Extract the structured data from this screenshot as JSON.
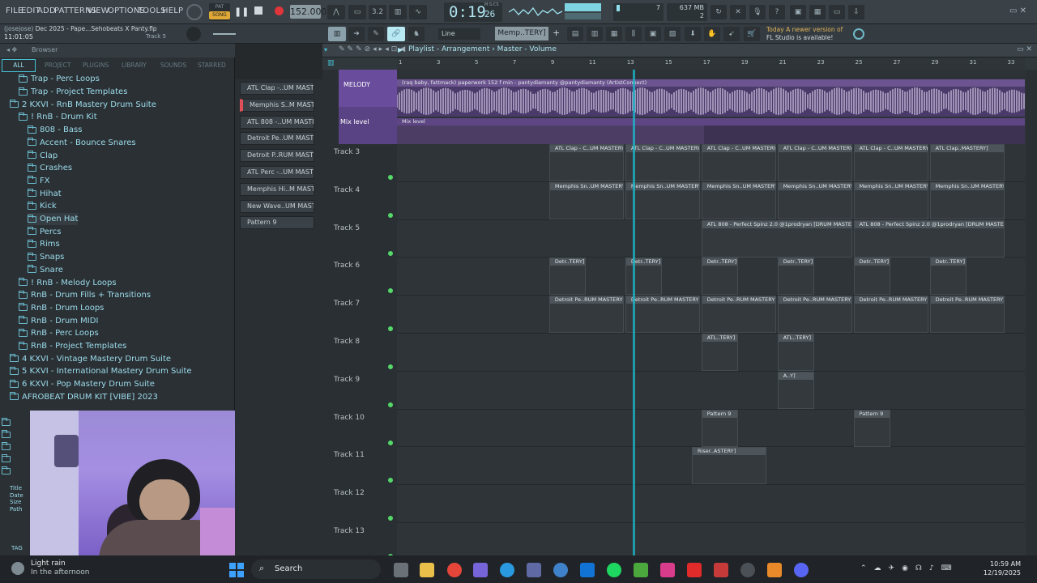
{
  "menu": {
    "items": [
      "FILE",
      "EDIT",
      "ADD",
      "PATTERNS",
      "VIEW",
      "OPTIONS",
      "TOOLS",
      "HELP"
    ]
  },
  "transport": {
    "pat_song_top": "PAT",
    "pat_song_bottom": "SONG",
    "tempo": "152.000",
    "time_main": "0:19",
    "time_sub": "26",
    "time_label": "M:S:CS",
    "cpu": "7",
    "memory": "637 MB",
    "voices": "2",
    "pattern_selector": "Memp..TERY]",
    "snap": "Line"
  },
  "project": {
    "user": "(josejose)",
    "project_name": "Dec 2025 - Pape...Sehobeats X Panty.flp",
    "time": "11:01:05",
    "track_hint": "Track 5"
  },
  "update_notice": {
    "line1": "Today  A newer version of",
    "line2": "FL Studio is available!"
  },
  "browser": {
    "title": "Browser",
    "tabs": [
      "ALL",
      "PROJECT",
      "PLUGINS",
      "LIBRARY",
      "SOUNDS",
      "STARRED"
    ],
    "items": [
      {
        "label": "Trap - Perc Loops",
        "indent": 2
      },
      {
        "label": "Trap - Project Templates",
        "indent": 2
      },
      {
        "label": "2 KXVI - RnB Mastery Drum Suite",
        "indent": 1
      },
      {
        "label": "! RnB - Drum Kit",
        "indent": 2
      },
      {
        "label": "808 - Bass",
        "indent": 3
      },
      {
        "label": "Accent - Bounce Snares",
        "indent": 3
      },
      {
        "label": "Clap",
        "indent": 3
      },
      {
        "label": "Crashes",
        "indent": 3
      },
      {
        "label": "FX",
        "indent": 3
      },
      {
        "label": "Hihat",
        "indent": 3
      },
      {
        "label": "Kick",
        "indent": 3
      },
      {
        "label": "Open Hat",
        "indent": 3
      },
      {
        "label": "Percs",
        "indent": 3
      },
      {
        "label": "Rims",
        "indent": 3
      },
      {
        "label": "Snaps",
        "indent": 3
      },
      {
        "label": "Snare",
        "indent": 3
      },
      {
        "label": "! RnB - Melody Loops",
        "indent": 2
      },
      {
        "label": "RnB - Drum Fills + Transitions",
        "indent": 2
      },
      {
        "label": "RnB - Drum Loops",
        "indent": 2
      },
      {
        "label": "RnB - Drum MIDI",
        "indent": 2
      },
      {
        "label": "RnB - Perc Loops",
        "indent": 2
      },
      {
        "label": "RnB - Project Templates",
        "indent": 2
      },
      {
        "label": "4 KXVI - Vintage Mastery Drum Suite",
        "indent": 1
      },
      {
        "label": "5 KXVI - International Mastery Drum Suite",
        "indent": 1
      },
      {
        "label": "6 KXVI - Pop Mastery Drum Suite",
        "indent": 1
      },
      {
        "label": "AFROBEAT DRUM KIT [VIBE] 2023",
        "indent": 1
      }
    ],
    "info_labels": [
      "Title",
      "Date",
      "Size",
      "Path"
    ],
    "tag_label": "TAG"
  },
  "channels": [
    "ATL Clap -..UM MASTERY]",
    "Memphis S..M MASTERY]",
    "ATL 808 -..UM MASTERY]",
    "Detroit Pe..UM MASTERY]",
    "Detroit P..RUM MASTERY]",
    "ATL Perc -..UM MASTERY]",
    "Memphis Hi..M MASTERY]",
    "New Wave..UM MASTERY]",
    "Pattern 9"
  ],
  "playlist": {
    "title": "Playlist - Arrangement › Master - Volume",
    "bar_numbers": [
      "1",
      "3",
      "5",
      "7",
      "9",
      "11",
      "13",
      "15",
      "17",
      "19",
      "21",
      "23",
      "25",
      "27",
      "29",
      "31",
      "33"
    ],
    "melody_track": {
      "name": "MELODY",
      "clip": "(raq baby, fattmack) paperwork 152 f min - pantydiamanty @pantydiamanty (ArtistConnect)"
    },
    "mix_track": {
      "name": "Mix level",
      "clip": "Mix level"
    },
    "tracks": [
      {
        "name": "Track 3",
        "clips": [
          {
            "label": "ATL Clap - C..UM MASTERY]",
            "bar": 9
          },
          {
            "label": "ATL Clap - C..UM MASTERY]",
            "bar": 13
          },
          {
            "label": "ATL Clap - C..UM MASTERY]",
            "bar": 17
          },
          {
            "label": "ATL Clap - C..UM MASTERY]",
            "bar": 21
          },
          {
            "label": "ATL Clap - C..UM MASTERY]",
            "bar": 25
          },
          {
            "label": "ATL Clap..MASTERY]",
            "bar": 29
          }
        ]
      },
      {
        "name": "Track 4",
        "clips": [
          {
            "label": "Memphis Sn..UM MASTERY]",
            "bar": 9
          },
          {
            "label": "Memphis Sn..UM MASTERY]",
            "bar": 13
          },
          {
            "label": "Memphis Sn..UM MASTERY]",
            "bar": 17
          },
          {
            "label": "Memphis Sn..UM MASTERY]",
            "bar": 21
          },
          {
            "label": "Memphis Sn..UM MASTERY]",
            "bar": 25
          },
          {
            "label": "Memphis Sn..UM MASTERY]",
            "bar": 29
          }
        ]
      },
      {
        "name": "Track 5",
        "clips": [
          {
            "label": "ATL 808 - Perfect Spinz 2.0 @1prodryan [DRUM MASTERY]",
            "bar": 17
          },
          {
            "label": "ATL 808 - Perfect Spinz 2.0 @1prodryan [DRUM MASTERY]",
            "bar": 25
          }
        ]
      },
      {
        "name": "Track 6",
        "clips": [
          {
            "label": "Detr..TERY]",
            "bar": 9
          },
          {
            "label": "Detr..TERY]",
            "bar": 13
          },
          {
            "label": "Detr..TERY]",
            "bar": 17
          },
          {
            "label": "Detr..TERY]",
            "bar": 21
          },
          {
            "label": "Detr..TERY]",
            "bar": 25
          },
          {
            "label": "Detr..TERY]",
            "bar": 29
          }
        ]
      },
      {
        "name": "Track 7",
        "clips": [
          {
            "label": "Detroit Pe..RUM MASTERY]",
            "bar": 9
          },
          {
            "label": "Detroit Pe..RUM MASTERY]",
            "bar": 13
          },
          {
            "label": "Detroit Pe..RUM MASTERY]",
            "bar": 17
          },
          {
            "label": "Detroit Pe..RUM MASTERY]",
            "bar": 21
          },
          {
            "label": "Detroit Pe..RUM MASTERY]",
            "bar": 25
          },
          {
            "label": "Detroit Pe..RUM MASTERY]",
            "bar": 29
          }
        ]
      },
      {
        "name": "Track 8",
        "clips": [
          {
            "label": "ATL..TERY]",
            "bar": 17
          },
          {
            "label": "ATL..TERY]",
            "bar": 21
          }
        ]
      },
      {
        "name": "Track 9",
        "clips": [
          {
            "label": "A..Y]",
            "bar": 21
          }
        ]
      },
      {
        "name": "Track 10",
        "clips": [
          {
            "label": "Pattern 9",
            "bar": 17
          },
          {
            "label": "Pattern 9",
            "bar": 25
          }
        ]
      },
      {
        "name": "Track 11",
        "clips": [
          {
            "label": "Riser..ASTERY]",
            "bar": 16.5
          }
        ]
      },
      {
        "name": "Track 12",
        "clips": []
      },
      {
        "name": "Track 13",
        "clips": []
      }
    ]
  },
  "taskbar": {
    "weather_line1": "Light rain",
    "weather_line2": "In the afternoon",
    "search": "Search",
    "time": "10:59 AM",
    "date": "12/19/2025"
  },
  "colors": {
    "accent": "#3fc8d8",
    "melody": "#7a5aa8",
    "mix": "#5d4683",
    "track_bg": "#2f3438"
  }
}
